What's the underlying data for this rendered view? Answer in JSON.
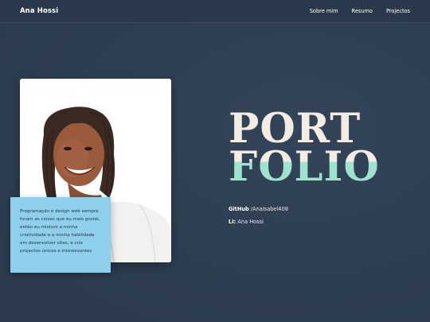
{
  "header": {
    "brand": "Ana Hossi",
    "nav": [
      "Sobre mim",
      "Resumo",
      "Projectos"
    ]
  },
  "hero": {
    "title_line1": "PORT",
    "title_line2": "FOLIO",
    "bio": "Programação e design web sempre foram as coisas que eu mais gostei, então eu misturo a minha criatividade e a minha habilidade em desenvolver sites, e crio projectos únicos e interessantes",
    "github_label": "GitHub",
    "github_value": " /AnaIsabel408",
    "linkedin_label": "LI:",
    "linkedin_value": " Ana Hossi"
  },
  "colors": {
    "background": "#2e3e51",
    "accent_mint": "#9fe3cf",
    "bio_box": "#8ecfec",
    "title_cream": "#f3ece3"
  },
  "icons": [
    "profile-photo"
  ]
}
